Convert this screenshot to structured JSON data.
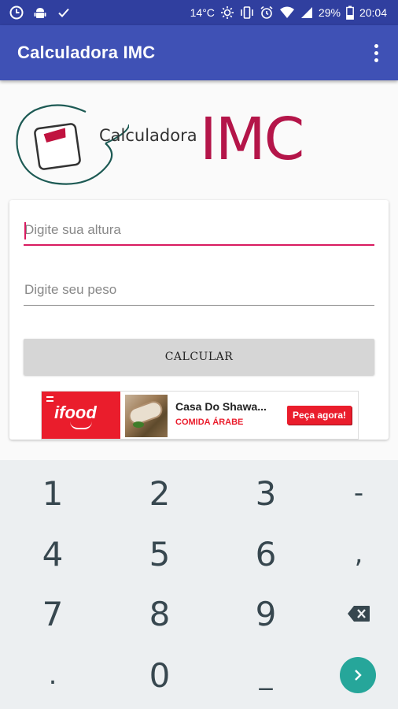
{
  "status_bar": {
    "temperature": "14°C",
    "battery": "29%",
    "time": "20:04"
  },
  "app_bar": {
    "title": "Calculadora IMC"
  },
  "logo": {
    "small_text": "Calculadora",
    "big_text": "IMC"
  },
  "form": {
    "height_placeholder": "Digite sua altura",
    "height_value": "",
    "weight_placeholder": "Digite seu peso",
    "weight_value": "",
    "calculate_label": "CALCULAR"
  },
  "ad": {
    "brand": "ifood",
    "title": "Casa Do Shawa...",
    "subtitle": "COMIDA ÁRABE",
    "cta": "Peça agora!"
  },
  "keyboard": {
    "keys": [
      "1",
      "2",
      "3",
      "-",
      "4",
      "5",
      "6",
      ",",
      "7",
      "8",
      "9",
      ".",
      "0",
      "_"
    ]
  },
  "colors": {
    "status_bar": "#303f9f",
    "app_bar": "#3f51b5",
    "accent": "#d81b60",
    "logo_imc": "#b41549",
    "ifood_red": "#ea1d2c",
    "enter_key": "#26a69a",
    "keyboard_bg": "#eceff1"
  },
  "icons": [
    "app-notification-icon",
    "android-icon",
    "check-icon",
    "brightness-icon",
    "vibrate-icon",
    "alarm-icon",
    "wifi-icon",
    "signal-icon",
    "battery-icon",
    "more-vert-icon",
    "scale-icon",
    "backspace-icon",
    "chevron-right-icon"
  ]
}
